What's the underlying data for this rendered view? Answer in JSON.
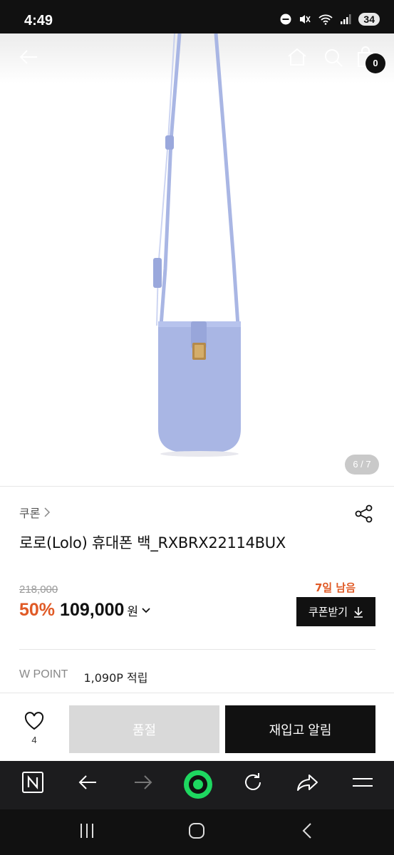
{
  "status_bar": {
    "time": "4:49",
    "battery": "34"
  },
  "header": {
    "back_icon": "arrow-left-icon",
    "home_icon": "home-icon",
    "search_icon": "search-icon",
    "cart_icon": "shopping-bag-icon",
    "cart_count": "0"
  },
  "gallery": {
    "counter": "6 / 7"
  },
  "product": {
    "brand": "쿠론",
    "title": "로로(Lolo) 휴대폰 백_RXBRX22114BUX",
    "original_price": "218,000",
    "discount": "50%",
    "price": "109,000",
    "currency": "원",
    "days_left": "7일 남음",
    "coupon_label": "쿠폰받기",
    "point_label": "W POINT",
    "point_value": "1,090P 적립"
  },
  "action_bar": {
    "like_count": "4",
    "soldout_label": "품절",
    "restock_label": "재입고 알림"
  },
  "colors": {
    "accent": "#e05a26",
    "bag": "#a9b6e4",
    "dark": "#111111"
  }
}
